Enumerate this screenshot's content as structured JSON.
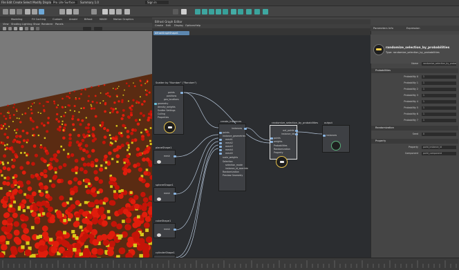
{
  "statusbar": {
    "workspace_label": "Pro Lite Surface",
    "summary_label": "Summary 1.0",
    "sign_in_label": "Sign in"
  },
  "shelf": {
    "tabs": [
      "Modeling",
      "FX Caching",
      "Custom",
      "Arnold",
      "Bifrost",
      "MASH",
      "Motion Graphics"
    ]
  },
  "viewport": {
    "menu": [
      "View",
      "Shading",
      "Lighting",
      "Show",
      "Renderer",
      "Panels"
    ]
  },
  "node_editor": {
    "window_title": "Bifrost Graph Editor",
    "menu": [
      "Create",
      "Edit",
      "Display",
      "Options",
      "Help"
    ],
    "tab_label": "bifrostGraphShape1",
    "nodes": {
      "scatter": {
        "title": "Scatter by \"Number\" (\"Random\")",
        "rows": [
          "points",
          "positions",
          "geo_locations",
          "geometry",
          "density_weights",
          "Scatter Settings",
          "Culling",
          "Properties"
        ]
      },
      "plane": {
        "title": "planeShape1",
        "rows": [
          "mesh"
        ]
      },
      "sphere": {
        "title": "sphereShape1",
        "rows": [
          "mesh"
        ]
      },
      "cube": {
        "title": "cubeShape1",
        "rows": [
          "mesh"
        ]
      },
      "cylinder": {
        "title": "cylinderShape1",
        "rows": [
          "mesh"
        ]
      },
      "torus": {
        "title": "torusShape1",
        "rows": [
          "mesh"
        ]
      },
      "create": {
        "title": "create_instances",
        "rows": [
          "instances",
          "points",
          "instance_geometries",
          "mesh1",
          "mesh2",
          "mesh3",
          "mesh4",
          "mesh5",
          "scale_weights",
          "Selection",
          "selection_mode",
          "instance_id_override",
          "Randomization",
          "Preview Geometry"
        ]
      },
      "random": {
        "title": "randomize_selection_by_probabilities",
        "rows": [
          "out_points",
          "instance_ids",
          "points",
          "weights",
          "Probabilities",
          "Randomization",
          "Property"
        ]
      },
      "output": {
        "title": "output",
        "rows": [
          "instances"
        ]
      }
    }
  },
  "panel": {
    "tabs": [
      "Parameters",
      "Info",
      "Expression"
    ],
    "node_name": "randomize_selection_by_probabilities",
    "node_type": "Type: randomize_selection_by_probabilities",
    "name_label": "Name",
    "name_value": "randomize_selection_by_probabilities",
    "sections": {
      "probabilities": "Probabilities",
      "randomization": "Randomization",
      "property": "Property"
    },
    "probabilities": [
      {
        "label": "Probability 0",
        "value": "1"
      },
      {
        "label": "Probability 1",
        "value": "1"
      },
      {
        "label": "Probability 2",
        "value": "1"
      },
      {
        "label": "Probability 3",
        "value": "1"
      },
      {
        "label": "Probability 4",
        "value": "1"
      },
      {
        "label": "Probability 5",
        "value": "1"
      },
      {
        "label": "Probability 6",
        "value": "1"
      },
      {
        "label": "Probability 7",
        "value": "1"
      }
    ],
    "seed_label": "Seed",
    "seed_value": "0",
    "property_label": "Property",
    "property_value": "point_instance_id",
    "component_label": "Component",
    "component_value": "point_component"
  }
}
